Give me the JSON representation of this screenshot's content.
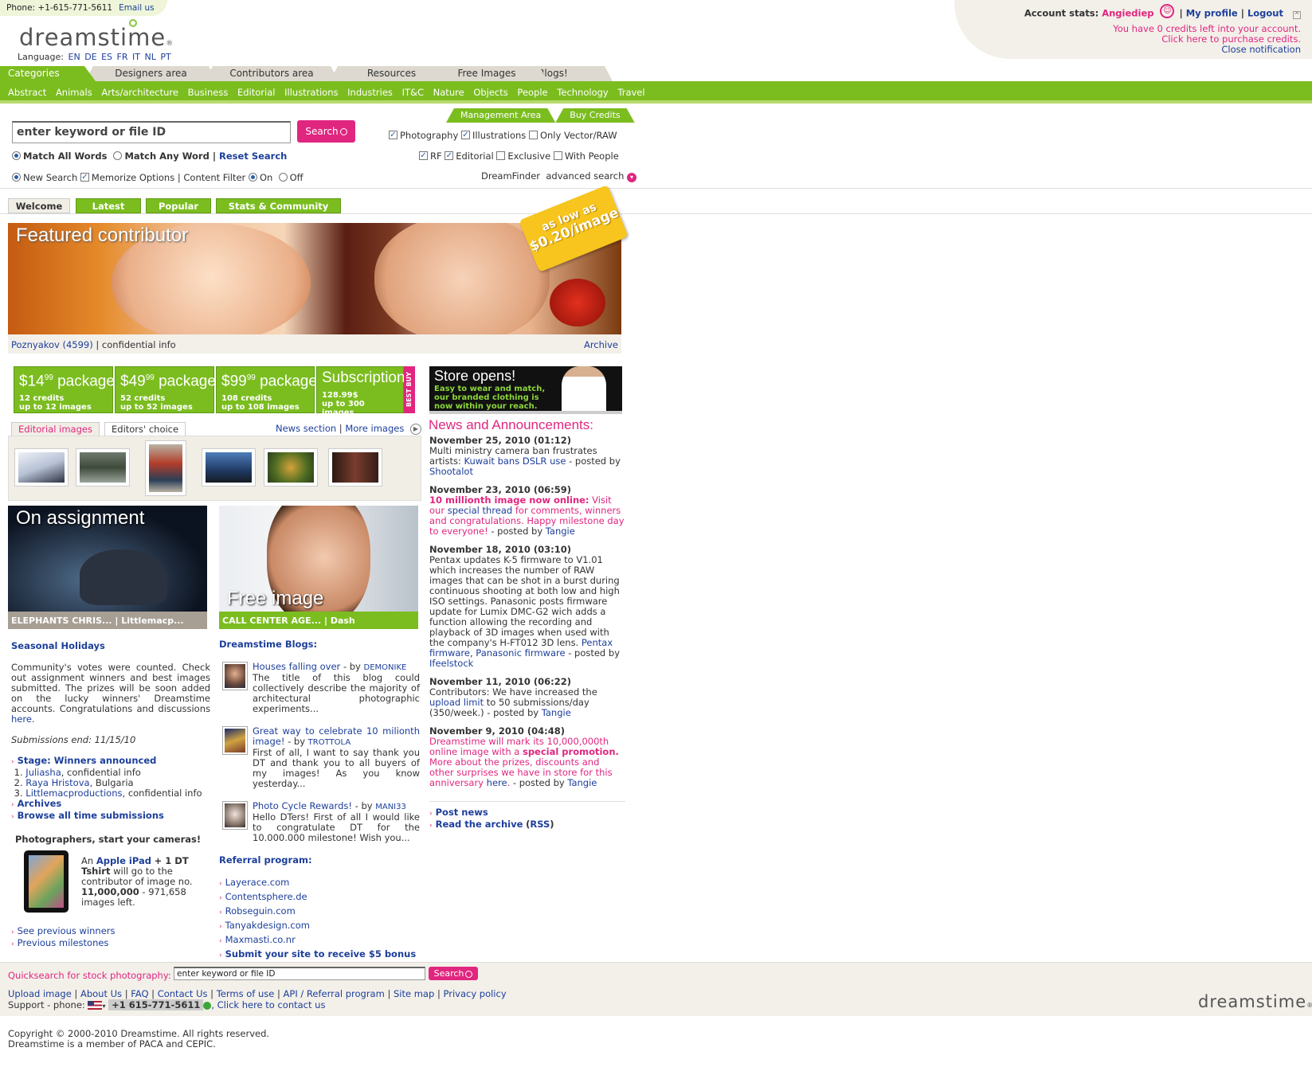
{
  "topbar": {
    "phone": "Phone: +1-615-771-5611",
    "email": "Email us"
  },
  "logo": "dreamstime",
  "language": {
    "label": "Language:",
    "codes": [
      "EN",
      "DE",
      "ES",
      "FR",
      "IT",
      "NL",
      "PT"
    ]
  },
  "account": {
    "label": "Account stats:",
    "user": "Angiediep",
    "profile": "My profile",
    "logout": "Logout",
    "credits_line": "You have 0 credits left into your account.",
    "purchase_line": "Click here to purchase credits.",
    "close": "Close notification"
  },
  "main_tabs": [
    "Categories",
    "Designers area",
    "Contributors area",
    "Resources",
    "Free Images",
    "Blogs!"
  ],
  "categories": [
    "Abstract",
    "Animals",
    "Arts/architecture",
    "Business",
    "Editorial",
    "Illustrations",
    "Industries",
    "IT&C",
    "Nature",
    "Objects",
    "People",
    "Technology",
    "Travel"
  ],
  "subtabs": [
    "Management Area",
    "Buy Credits"
  ],
  "search": {
    "value": "enter keyword or file ID",
    "button": "Search",
    "match_all": "Match All Words",
    "match_any": "Match Any Word",
    "reset": "Reset Search",
    "new_search": "New Search",
    "memorize": "Memorize Options",
    "content_filter": "Content Filter",
    "on": "On",
    "off": "Off",
    "photography": "Photography",
    "illustrations": "Illustrations",
    "vector": "Only Vector/RAW",
    "rf": "RF",
    "editorial": "Editorial",
    "exclusive": "Exclusive",
    "with_people": "With People",
    "dreamfinder": "DreamFinder",
    "advanced": "advanced search"
  },
  "section_tabs": [
    "Welcome",
    "Latest",
    "Popular",
    "Stats & Community"
  ],
  "banner": {
    "title": "Featured contributor",
    "tag_line1": "as low as",
    "tag_line2": "$0.20/image",
    "contributor": "Poznyakov",
    "count": "(4599)",
    "info": "| confidential info",
    "archive": "Archive"
  },
  "packages": [
    {
      "price": "$14",
      "cents": "99",
      "name": "package",
      "l1": "12 credits",
      "l2": "up to 12 images"
    },
    {
      "price": "$49",
      "cents": "99",
      "name": "package",
      "l1": "52 credits",
      "l2": "up to 52 images"
    },
    {
      "price": "$99",
      "cents": "99",
      "name": "package",
      "l1": "108 credits",
      "l2": "up to 108 images"
    },
    {
      "price": "Subscription",
      "cents": "",
      "name": "",
      "l1": "128.99$",
      "l2": "up to 300 images"
    }
  ],
  "best_buy": "BEST BUY",
  "store": {
    "title": "Store opens!",
    "text": "Easy to wear and match, our branded clothing is now within your reach."
  },
  "editorial": {
    "tab1": "Editorial images",
    "tab2": "Editors' choice",
    "news_section": "News section",
    "more_images": "More images"
  },
  "assignment": {
    "title": "On assignment",
    "caption": "ELEPHANTS CHRIS... | Littlemacp..."
  },
  "free_image": {
    "title": "Free image",
    "caption": "CALL CENTER AGE... | Dash"
  },
  "seasonal": {
    "title": "Seasonal Holidays",
    "text": "Community's votes were counted. Check out assignment winners and best images submitted. The prizes will be soon added on the lucky winners' Dreamstime accounts. Congratulations and discussions",
    "here": "here.",
    "submissions_end": "Submissions end: 11/15/10",
    "stage": "Stage: Winners announced",
    "winners": [
      {
        "n": "1.",
        "name": "Juliasha",
        "info": ", confidential info"
      },
      {
        "n": "2.",
        "name": "Raya Hristova",
        "info": ", Bulgaria"
      },
      {
        "n": "3.",
        "name": "Littlemacproductions",
        "info": ", confidential info"
      }
    ],
    "archives": "Archives",
    "browse": "Browse all time submissions",
    "photographers": "Photographers, start your cameras!",
    "ipad_an": "An",
    "ipad_link": "Apple iPad",
    "ipad_plus": "+ 1 DT",
    "ipad_tshirt": "Tshirt",
    "ipad_rest": "will go to the contributor of image no.",
    "ipad_no": "11,000,000",
    "ipad_left": "- 971,658 images left.",
    "see_prev": "See previous winners",
    "prev_milestones": "Previous milestones"
  },
  "blogs": {
    "title": "Dreamstime Blogs:",
    "items": [
      {
        "link": "Houses falling over",
        "by": "- by",
        "author": "DEMONIKE",
        "text": "The title of this blog could collectively describe the majority of architectural photographic experiments..."
      },
      {
        "link": "Great way to celebrate 10 milionth image!",
        "by": "- by",
        "author": "TROTTOLA",
        "text": "First of all, I want to say thank you DT and thank you to all buyers of my images! As you know yesterday..."
      },
      {
        "link": "Photo Cycle Rewards!",
        "by": "- by",
        "author": "MANI33",
        "text": "Hello DTers! First of all I would like to congratulate DT for the 10.000.000 milestone! Wish you..."
      }
    ]
  },
  "referral": {
    "title": "Referral program:",
    "sites": [
      "Layerace.com",
      "Contentsphere.de",
      "Robseguin.com",
      "Tanyakdesign.com",
      "Maxmasti.co.nr"
    ],
    "submit": "Submit your site to receive $5 bonus"
  },
  "news": {
    "title": "News and Announcements:",
    "items": [
      {
        "date": "November 25, 2010 (01:12)"
      },
      {
        "date": "November 23, 2010 (06:59)"
      },
      {
        "date": "November 18, 2010 (03:10)"
      },
      {
        "date": "November 11, 2010 (06:22)"
      },
      {
        "date": "November 9, 2010 (04:48)"
      }
    ],
    "post_news": "Post news",
    "read_archive": "Read the archive",
    "rss": "RSS"
  },
  "footer": {
    "quicksearch": "Quicksearch for stock photography:",
    "input": "enter keyword or file ID",
    "button": "Search",
    "links": [
      "Upload image",
      "About Us",
      "FAQ",
      "Contact Us",
      "Terms of use",
      "API / Referral program",
      "Site map",
      "Privacy policy"
    ],
    "support": "Support - phone:",
    "phone": "+1 615-771-5611",
    "contact": ", Click here to contact us",
    "copy1": "Copyright © 2000-2010 Dreamstime. All rights reserved.",
    "copy2": "Dreamstime is a member of PACA and CEPIC."
  }
}
